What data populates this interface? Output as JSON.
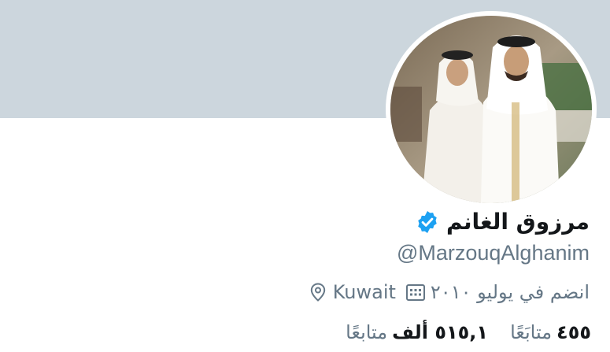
{
  "profile": {
    "display_name": "مرزوق الغانم",
    "handle": "@MarzouqAlghanim",
    "verified": true,
    "location": "Kuwait",
    "joined": "انضم في يوليو ٢٠١٠",
    "stats": {
      "following_value": "٤٥٥",
      "following_label": "متابَعًا",
      "followers_value": "٥١٥,١ ألف",
      "followers_label": "متابعًا"
    }
  },
  "colors": {
    "banner": "#ccd6dd",
    "verified_badge": "#1da1f2",
    "secondary_text": "#657786",
    "primary_text": "#14171a"
  },
  "icons": {
    "verified": "verified-badge-icon",
    "location": "location-pin-icon",
    "calendar": "calendar-icon"
  }
}
